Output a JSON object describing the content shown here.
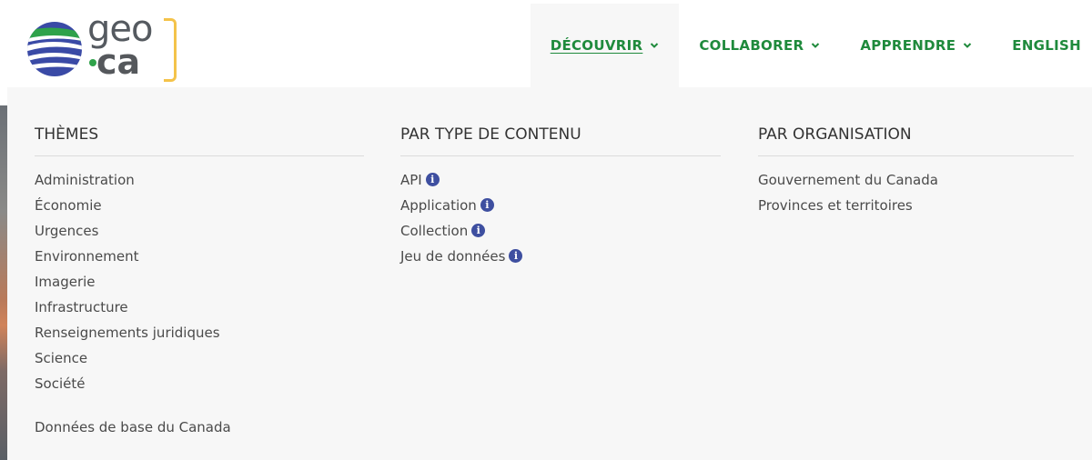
{
  "logo": {
    "text_top": "geo",
    "text_bottom": "ca"
  },
  "nav": {
    "items": [
      {
        "label": "DÉCOUVRIR",
        "has_dropdown": true,
        "active": true
      },
      {
        "label": "COLLABORER",
        "has_dropdown": true,
        "active": false
      },
      {
        "label": "APPRENDRE",
        "has_dropdown": true,
        "active": false
      },
      {
        "label": "ENGLISH",
        "has_dropdown": false,
        "active": false
      }
    ]
  },
  "menu": {
    "themes": {
      "heading": "THÈMES",
      "items": [
        "Administration",
        "Économie",
        "Urgences",
        "Environnement",
        "Imagerie",
        "Infrastructure",
        "Renseignements juridiques",
        "Science",
        "Société"
      ],
      "extra": "Données de base du Canada"
    },
    "content_type": {
      "heading": "PAR TYPE DE CONTENU",
      "items": [
        "API",
        "Application",
        "Collection",
        "Jeu de données"
      ],
      "info_icon": "i"
    },
    "organisation": {
      "heading": "PAR ORGANISATION",
      "items": [
        "Gouvernement du Canada",
        "Provinces et territoires"
      ]
    }
  },
  "colors": {
    "nav_green": "#1f8a3c",
    "info_blue": "#3e4fa0",
    "menu_bg": "#f7f7f7",
    "logo_bracket": "#f4c34a"
  }
}
